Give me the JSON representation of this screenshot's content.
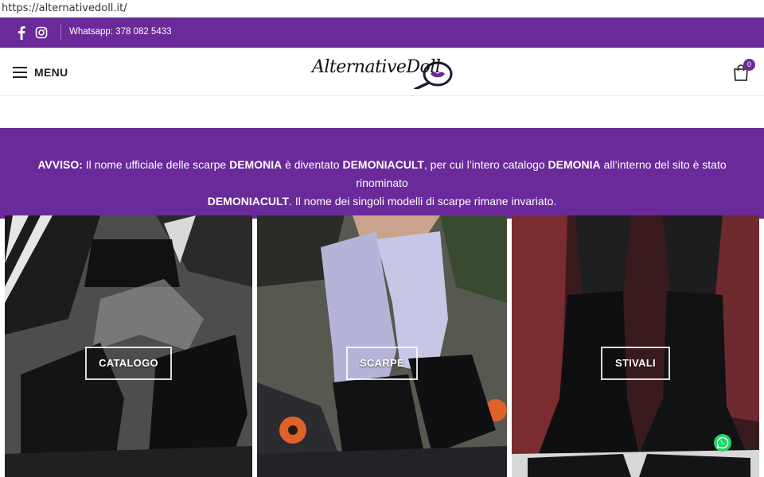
{
  "browser": {
    "url": "https://alternativedoll.it/"
  },
  "topbar": {
    "facebook_icon": "facebook-icon",
    "instagram_icon": "instagram-icon",
    "whatsapp_text": "Whatsapp: 378 082 5433",
    "bg_color": "#6a2a99"
  },
  "header": {
    "menu_label": "MENU",
    "logo_text": "AlternativeDoll",
    "cart_count": "0"
  },
  "notice": {
    "line1_a": "AVVISO:",
    "line1_b": " Il nome ufficiale delle scarpe ",
    "line1_c": "DEMONIA",
    "line1_d": " è diventato ",
    "line1_e": "DEMONIACULT",
    "line1_f": ", per cui l’intero catalogo ",
    "line1_g": "DEMONIA",
    "line1_h": " all’interno del sito è stato rinominato",
    "line2_a": "DEMONIACULT",
    "line2_b": ". Il nome dei singoli modelli di scarpe rimane invariato."
  },
  "categories": [
    {
      "label": "CATALOGO"
    },
    {
      "label": "SCARPE"
    },
    {
      "label": "STIVALI"
    }
  ]
}
